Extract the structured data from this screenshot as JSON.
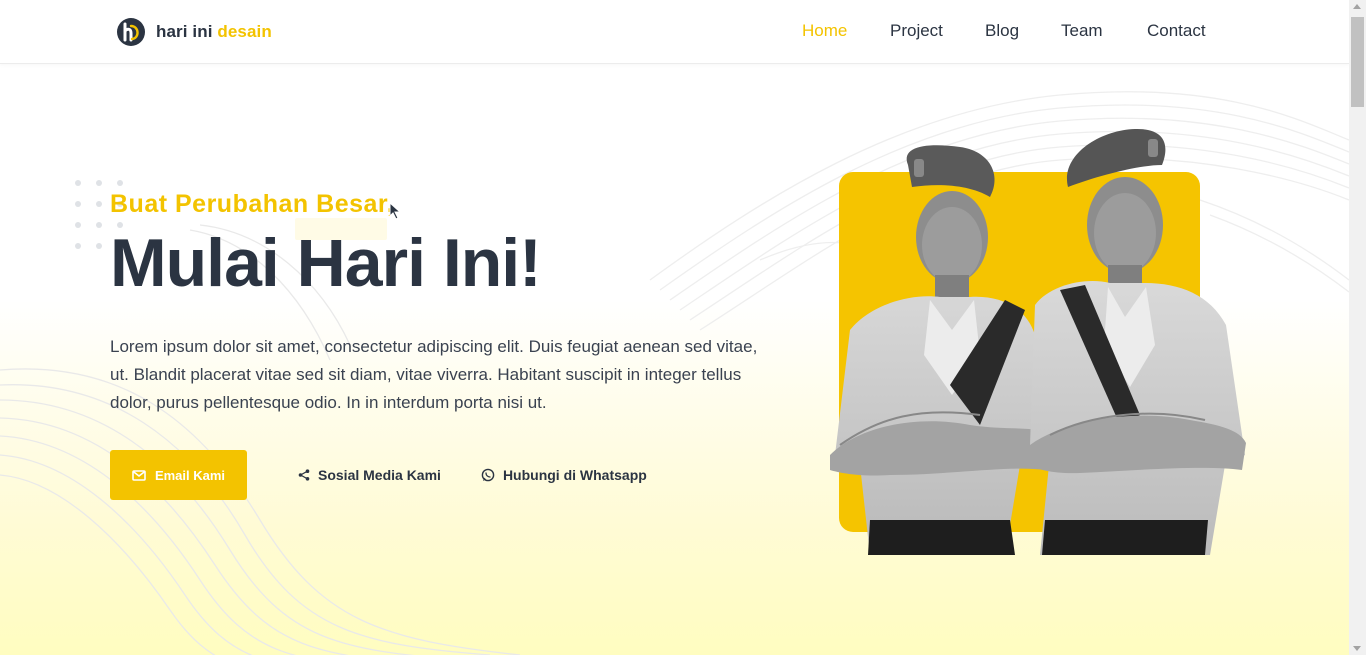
{
  "brand": {
    "name_part1": "hari ini",
    "name_part2": "desain",
    "logo_icon": "hd-monogram-icon"
  },
  "nav": {
    "items": [
      {
        "label": "Home",
        "active": true
      },
      {
        "label": "Project",
        "active": false
      },
      {
        "label": "Blog",
        "active": false
      },
      {
        "label": "Team",
        "active": false
      },
      {
        "label": "Contact",
        "active": false
      }
    ]
  },
  "hero": {
    "kicker": "Buat Perubahan Besar,",
    "title": "Mulai Hari Ini!",
    "description": "Lorem ipsum dolor sit amet, consectetur adipiscing elit. Duis feugiat aenean sed vitae, ut. Blandit placerat vitae sed sit diam, vitae viverra. Habitant suscipit in integer tellus dolor, purus pellentesque odio. In in interdum porta nisi ut.",
    "buttons": {
      "email": "Email Kami",
      "social": "Sosial Media Kami",
      "whatsapp": "Hubungi di Whatsapp"
    }
  },
  "colors": {
    "accent": "#f3c300",
    "dark": "#2b3442",
    "photo_bg": "#f5c400"
  },
  "icons": {
    "email": "envelope-icon",
    "social": "share-icon",
    "whatsapp": "whatsapp-icon"
  }
}
